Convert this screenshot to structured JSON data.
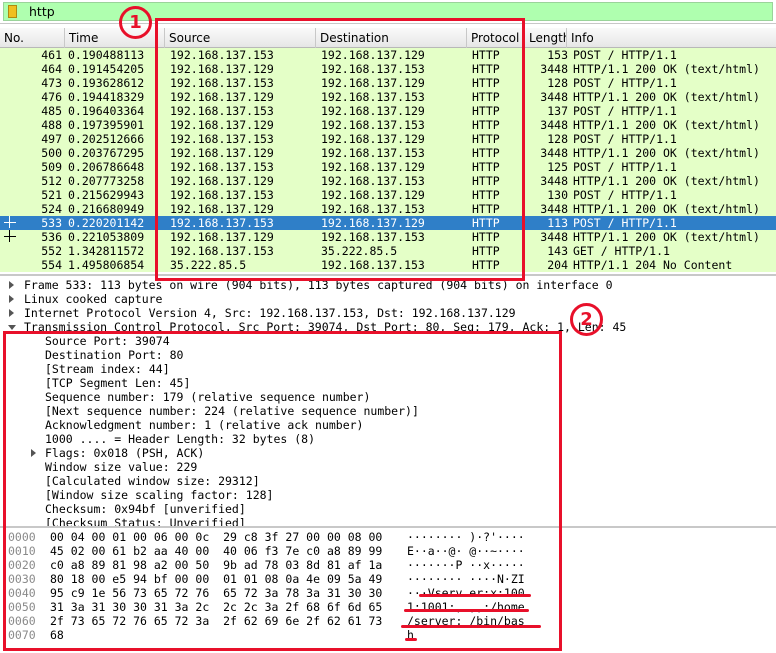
{
  "filter": {
    "value": "http"
  },
  "columns": [
    "No.",
    "Time",
    "Source",
    "Destination",
    "Protocol",
    "Length",
    "Info"
  ],
  "packets": [
    {
      "no": "461",
      "time": "0.190488113",
      "src": "192.168.137.153",
      "dst": "192.168.137.129",
      "proto": "HTTP",
      "len": "153",
      "info": "POST / HTTP/1.1"
    },
    {
      "no": "464",
      "time": "0.191454205",
      "src": "192.168.137.129",
      "dst": "192.168.137.153",
      "proto": "HTTP",
      "len": "3448",
      "info": "HTTP/1.1 200 OK  (text/html)"
    },
    {
      "no": "473",
      "time": "0.193628612",
      "src": "192.168.137.153",
      "dst": "192.168.137.129",
      "proto": "HTTP",
      "len": "128",
      "info": "POST / HTTP/1.1"
    },
    {
      "no": "476",
      "time": "0.194418329",
      "src": "192.168.137.129",
      "dst": "192.168.137.153",
      "proto": "HTTP",
      "len": "3448",
      "info": "HTTP/1.1 200 OK  (text/html)"
    },
    {
      "no": "485",
      "time": "0.196403364",
      "src": "192.168.137.153",
      "dst": "192.168.137.129",
      "proto": "HTTP",
      "len": "137",
      "info": "POST / HTTP/1.1"
    },
    {
      "no": "488",
      "time": "0.197395901",
      "src": "192.168.137.129",
      "dst": "192.168.137.153",
      "proto": "HTTP",
      "len": "3448",
      "info": "HTTP/1.1 200 OK  (text/html)"
    },
    {
      "no": "497",
      "time": "0.202512666",
      "src": "192.168.137.153",
      "dst": "192.168.137.129",
      "proto": "HTTP",
      "len": "128",
      "info": "POST / HTTP/1.1"
    },
    {
      "no": "500",
      "time": "0.203767295",
      "src": "192.168.137.129",
      "dst": "192.168.137.153",
      "proto": "HTTP",
      "len": "3448",
      "info": "HTTP/1.1 200 OK  (text/html)"
    },
    {
      "no": "509",
      "time": "0.206786648",
      "src": "192.168.137.153",
      "dst": "192.168.137.129",
      "proto": "HTTP",
      "len": "125",
      "info": "POST / HTTP/1.1"
    },
    {
      "no": "512",
      "time": "0.207773258",
      "src": "192.168.137.129",
      "dst": "192.168.137.153",
      "proto": "HTTP",
      "len": "3448",
      "info": "HTTP/1.1 200 OK  (text/html)"
    },
    {
      "no": "521",
      "time": "0.215629943",
      "src": "192.168.137.153",
      "dst": "192.168.137.129",
      "proto": "HTTP",
      "len": "130",
      "info": "POST / HTTP/1.1"
    },
    {
      "no": "524",
      "time": "0.216680949",
      "src": "192.168.137.129",
      "dst": "192.168.137.153",
      "proto": "HTTP",
      "len": "3448",
      "info": "HTTP/1.1 200 OK  (text/html)"
    },
    {
      "no": "533",
      "time": "0.220201142",
      "src": "192.168.137.153",
      "dst": "192.168.137.129",
      "proto": "HTTP",
      "len": "113",
      "info": "POST / HTTP/1.1"
    },
    {
      "no": "536",
      "time": "0.221053809",
      "src": "192.168.137.129",
      "dst": "192.168.137.153",
      "proto": "HTTP",
      "len": "3448",
      "info": "HTTP/1.1 200 OK  (text/html)"
    },
    {
      "no": "552",
      "time": "1.342811572",
      "src": "192.168.137.153",
      "dst": "35.222.85.5",
      "proto": "HTTP",
      "len": "143",
      "info": "GET / HTTP/1.1"
    },
    {
      "no": "554",
      "time": "1.495806854",
      "src": "35.222.85.5",
      "dst": "192.168.137.153",
      "proto": "HTTP",
      "len": "204",
      "info": "HTTP/1.1 204 No Content"
    }
  ],
  "details": {
    "frame": "Frame 533: 113 bytes on wire (904 bits), 113 bytes captured (904 bits) on interface 0",
    "linux": "Linux cooked capture",
    "ip": "Internet Protocol Version 4, Src: 192.168.137.153, Dst: 192.168.137.129",
    "tcp": "Transmission Control Protocol, Src Port: 39074, Dst Port: 80, Seq: 179, Ack: 1, Len: 45",
    "tcp_fields": [
      "Source Port: 39074",
      "Destination Port: 80",
      "[Stream index: 44]",
      "[TCP Segment Len: 45]",
      "Sequence number: 179    (relative sequence number)",
      "[Next sequence number: 224    (relative sequence number)]",
      "Acknowledgment number: 1    (relative ack number)",
      "1000 .... = Header Length: 32 bytes (8)",
      "Flags: 0x018 (PSH, ACK)",
      "Window size value: 229",
      "[Calculated window size: 29312]",
      "[Window size scaling factor: 128]",
      "Checksum: 0x94bf [unverified]",
      "[Checksum Status: Unverified]"
    ]
  },
  "bytes": [
    {
      "off": "0000",
      "hex": "00 04 00 01 00 06 00 0c  29 c8 3f 27 00 00 08 00",
      "ascii": "········ )·?'····"
    },
    {
      "off": "0010",
      "hex": "45 02 00 61 b2 aa 40 00  40 06 f3 7e c0 a8 89 99",
      "ascii": "E··a··@· @··~····"
    },
    {
      "off": "0020",
      "hex": "c0 a8 89 81 98 a2 00 50  9b ad 78 03 8d 81 af 1a",
      "ascii": "·······P ··x·····"
    },
    {
      "off": "0030",
      "hex": "80 18 00 e5 94 bf 00 00  01 01 08 0a 4e 09 5a 49",
      "ascii": "········ ····N·ZI"
    },
    {
      "off": "0040",
      "hex": "95 c9 1e 56 73 65 72 76  65 72 3a 78 3a 31 30 30",
      "ascii": "···Vserv er:x:100"
    },
    {
      "off": "0050",
      "hex": "31 3a 31 30 30 31 3a 2c  2c 2c 3a 2f 68 6f 6d 65",
      "ascii": "1:1001:, ,,:/home"
    },
    {
      "off": "0060",
      "hex": "2f 73 65 72 76 65 72 3a  2f 62 69 6e 2f 62 61 73",
      "ascii": "/server: /bin/bas"
    },
    {
      "off": "0070",
      "hex": "68",
      "ascii": "h"
    }
  ],
  "annotations": {
    "badge1": "1",
    "badge2": "2",
    "color": "#e8102a"
  },
  "colors": {
    "http_row": "#e4ffc7",
    "selected_row": "#2f7fc8",
    "filter_ok": "#afffaf"
  }
}
